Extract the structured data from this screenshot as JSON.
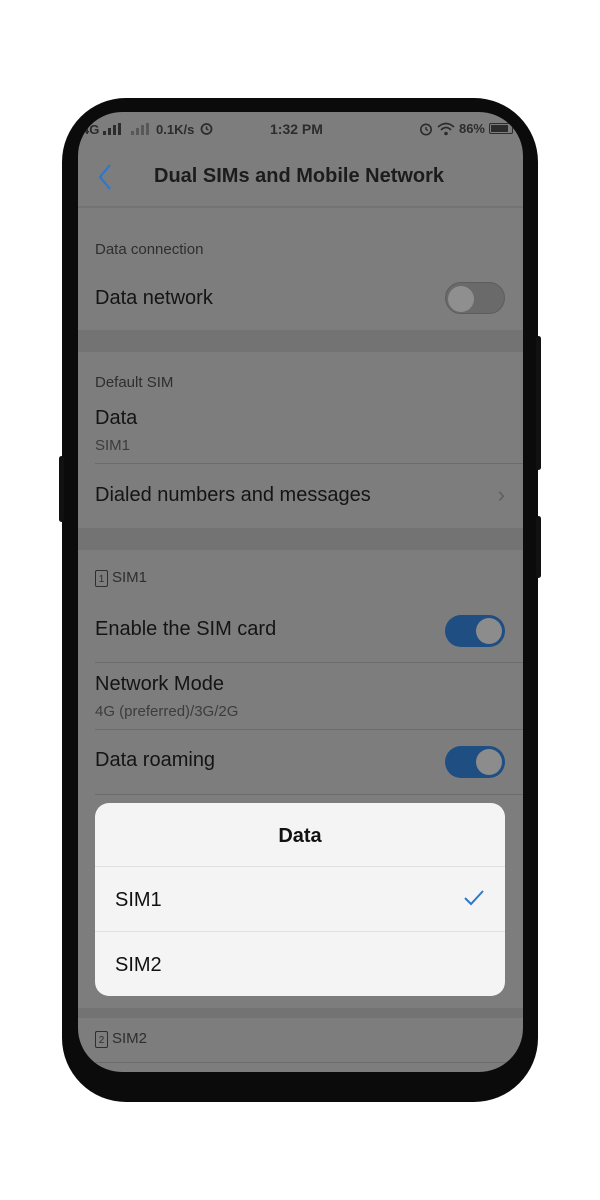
{
  "status_bar": {
    "signal": "4G",
    "speed": "0.1K/s",
    "time": "1:32 PM",
    "battery": "86%",
    "icons": [
      "signal-icon",
      "alarm-icon",
      "wifi-icon",
      "battery-icon"
    ]
  },
  "header": {
    "title": "Dual SIMs and Mobile Network",
    "back_icon": "chevron-left-icon"
  },
  "sections": {
    "data_connection": "Data connection",
    "default_sim": "Default SIM",
    "sim1": "SIM1",
    "sim2": "SIM2"
  },
  "settings": {
    "data_network": {
      "label": "Data network",
      "enabled": false
    },
    "data": {
      "label": "Data",
      "value": "SIM1"
    },
    "dialed": {
      "label": "Dialed numbers and messages"
    },
    "enable_sim": {
      "label": "Enable the SIM card",
      "enabled": true
    },
    "network_mode": {
      "label": "Network Mode",
      "value": "4G (preferred)/3G/2G"
    },
    "data_roaming": {
      "label": "Data roaming",
      "enabled": true
    }
  },
  "dialog": {
    "title": "Data",
    "options": [
      "SIM1",
      "SIM2"
    ],
    "selected": "SIM1"
  },
  "colors": {
    "accent": "#2e78c9",
    "toggle_on": "#1f4e82",
    "overlay": "#7d7d7d"
  }
}
